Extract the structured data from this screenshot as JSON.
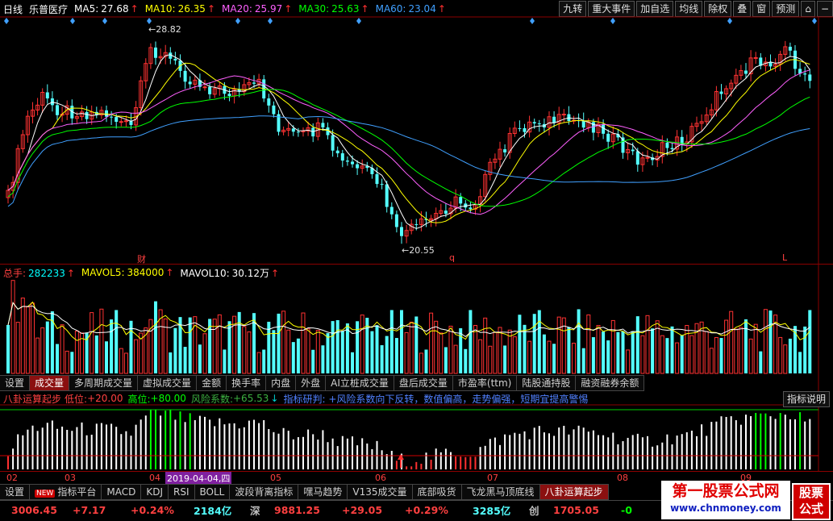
{
  "header": {
    "period": "日线",
    "stock_name": "乐普医疗",
    "ma": [
      {
        "label": "MA5:",
        "value": "27.68",
        "color": "#ffffff",
        "dir": "up"
      },
      {
        "label": "MA10:",
        "value": "26.35",
        "color": "#ffff00",
        "dir": "up"
      },
      {
        "label": "MA20:",
        "value": "25.97",
        "color": "#ff60ff",
        "dir": "up"
      },
      {
        "label": "MA30:",
        "value": "25.63",
        "color": "#00ff00",
        "dir": "up"
      },
      {
        "label": "MA60:",
        "value": "23.04",
        "color": "#40a0ff",
        "dir": "up"
      }
    ]
  },
  "toolbar": {
    "buttons": [
      "九转",
      "重大事件",
      "加自选",
      "均线",
      "除权",
      "叠",
      "窗",
      "预测"
    ]
  },
  "price_chart": {
    "high_label": "28.82",
    "low_label": "20.55",
    "markers": [
      "财",
      "q",
      "L"
    ]
  },
  "volume_header": {
    "items": [
      {
        "label": "总手:",
        "value": "282233",
        "color": "#00ffff",
        "dir": "up"
      },
      {
        "label": "MAVOL5:",
        "value": "384000",
        "color": "#ffff00",
        "dir": "up"
      },
      {
        "label": "MAVOL10:",
        "value": "30.12万",
        "color": "#ffffff",
        "dir": "up"
      }
    ]
  },
  "volume_tabs": [
    "设置",
    "成交量",
    "多周期成交量",
    "虚拟成交量",
    "金额",
    "换手率",
    "内盘",
    "外盘",
    "AI立桩成交量",
    "盘后成交量",
    "市盈率(ttm)",
    "陆股通持股",
    "融资融券余额"
  ],
  "volume_tab_active": 1,
  "indicator_header": {
    "name": "八卦运算起步",
    "low_label": "低位:",
    "low_value": "+20.00",
    "high_label": "高位:",
    "high_value": "+80.00",
    "risk_label": "风险系数:",
    "risk_value": "+65.53",
    "study_text": "指标研判: +风险系数向下反转，数值偏高，走势偏强，短期宜提高警惕",
    "explain_button": "指标说明"
  },
  "x_axis": {
    "months": [
      "02",
      "03",
      "04",
      "05",
      "06",
      "07",
      "08",
      "09"
    ],
    "cursor_date": "2019-04-04,四"
  },
  "indicator_tabs": [
    "设置",
    "指标平台",
    "MACD",
    "KDJ",
    "RSI",
    "BOLL",
    "波段背离指标",
    "嘿马趋势",
    "V135成交量",
    "底部吸货",
    "飞龙黑马顶底线",
    "八卦运算起步"
  ],
  "indicator_tab_active": 11,
  "new_badge": "NEW",
  "status_bar": {
    "sh_value": "3006.45",
    "sh_change": "+7.17",
    "sh_pct": "+0.24%",
    "sh_amount": "2184亿",
    "sz_label": "深",
    "sz_value": "9881.25",
    "sz_change": "+29.05",
    "sz_pct": "+0.29%",
    "sz_amount": "3285亿",
    "cy_label": "创",
    "cy_value": "1705.05",
    "cy_change": "-0"
  },
  "watermark": {
    "title": "第一股票公式网",
    "url": "www.chnmoney.com",
    "badge": "股票公式"
  },
  "colors": {
    "up": "#ff3232",
    "down": "#54ffff",
    "ma5": "#ffffff",
    "ma10": "#ffff00",
    "ma20": "#ff60ff",
    "ma30": "#00ff00",
    "ma60": "#40a0ff"
  }
}
